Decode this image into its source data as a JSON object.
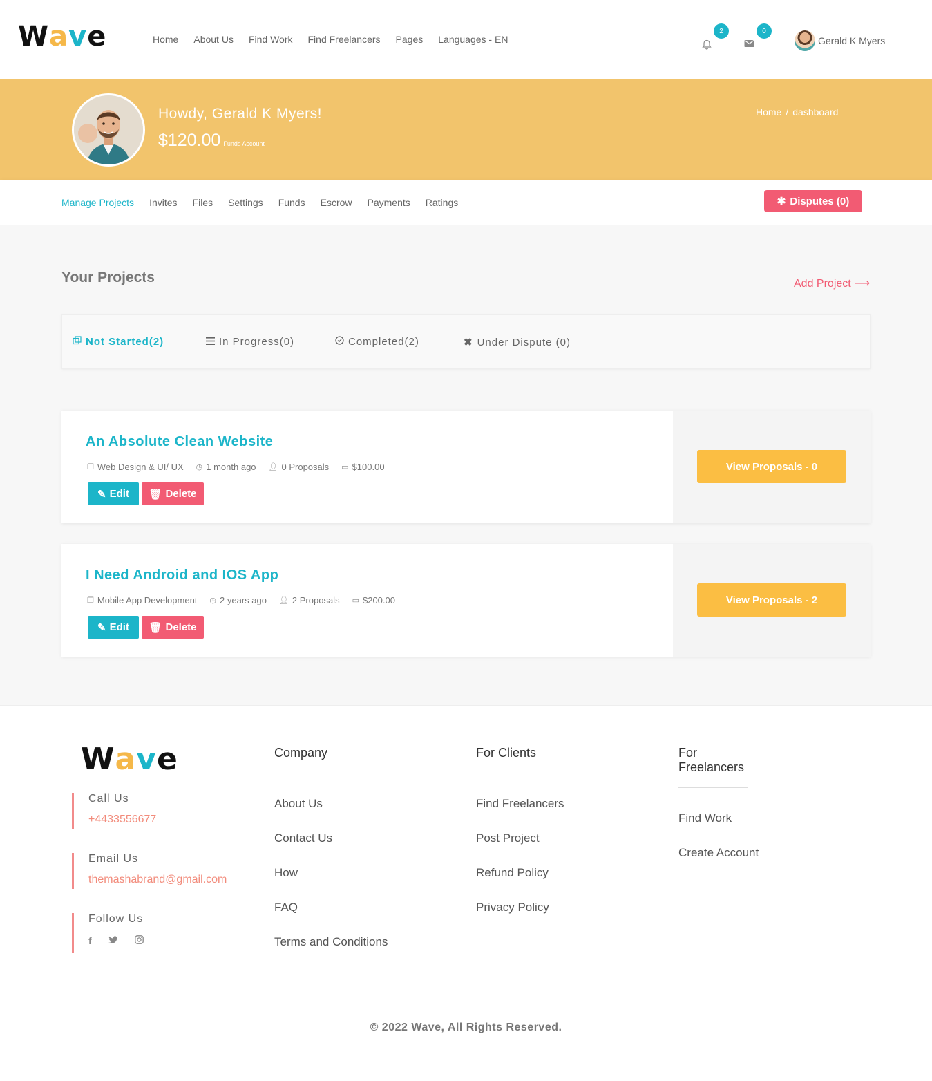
{
  "brand": {
    "logo_w": "W",
    "logo_a": "a",
    "logo_v": "v",
    "logo_e": "e"
  },
  "nav": {
    "items": [
      "Home",
      "About Us",
      "Find Work",
      "Find Freelancers",
      "Pages",
      "Languages - EN"
    ],
    "notifications_count": "2",
    "messages_count": "0",
    "user_name": "Gerald K Myers"
  },
  "banner": {
    "greeting": "Howdy, Gerald K Myers!",
    "balance": "$120.00",
    "balance_label": "Funds Account",
    "breadcrumb": [
      "Home",
      "dashboard"
    ],
    "breadcrumb_sep": "/"
  },
  "subnav": {
    "items": [
      "Manage Projects",
      "Invites",
      "Files",
      "Settings",
      "Funds",
      "Escrow",
      "Payments",
      "Ratings"
    ],
    "disputes_label": "Disputes (0)"
  },
  "projects": {
    "heading": "Your Projects",
    "add_label": "Add Project",
    "tabs": [
      "Not Started(2)",
      "In Progress(0)",
      "Completed(2)",
      "Under Dispute (0)"
    ],
    "edit_label": "Edit",
    "delete_label": "Delete",
    "items": [
      {
        "title": "An Absolute Clean Website",
        "category": "Web Design & UI/ UX",
        "posted": "1 month ago",
        "proposals": "0 Proposals",
        "budget": "$100.00",
        "view_label": "View Proposals - 0"
      },
      {
        "title": "I Need Android and IOS App",
        "category": "Mobile App Development",
        "posted": "2 years ago",
        "proposals": "2 Proposals",
        "budget": "$200.00",
        "view_label": "View Proposals - 2"
      }
    ]
  },
  "footer": {
    "call_label": "Call Us",
    "phone": "+4433556677",
    "email_label": "Email Us",
    "email": "themashabrand@gmail.com",
    "follow_label": "Follow Us",
    "columns": [
      {
        "title": "Company",
        "links": [
          "About Us",
          "Contact Us",
          "How",
          "FAQ",
          "Terms and Conditions"
        ]
      },
      {
        "title": "For Clients",
        "links": [
          "Find Freelancers",
          "Post Project",
          "Refund Policy",
          "Privacy Policy"
        ]
      },
      {
        "title": "For Freelancers",
        "links": [
          "Find Work",
          "Create Account"
        ]
      }
    ],
    "copyright": "© 2022 Wave, All Rights Reserved."
  },
  "colors": {
    "accent": "#1cb5c9",
    "banner": "#f2c46c",
    "danger": "#f25b73",
    "cta": "#fbbe43"
  }
}
